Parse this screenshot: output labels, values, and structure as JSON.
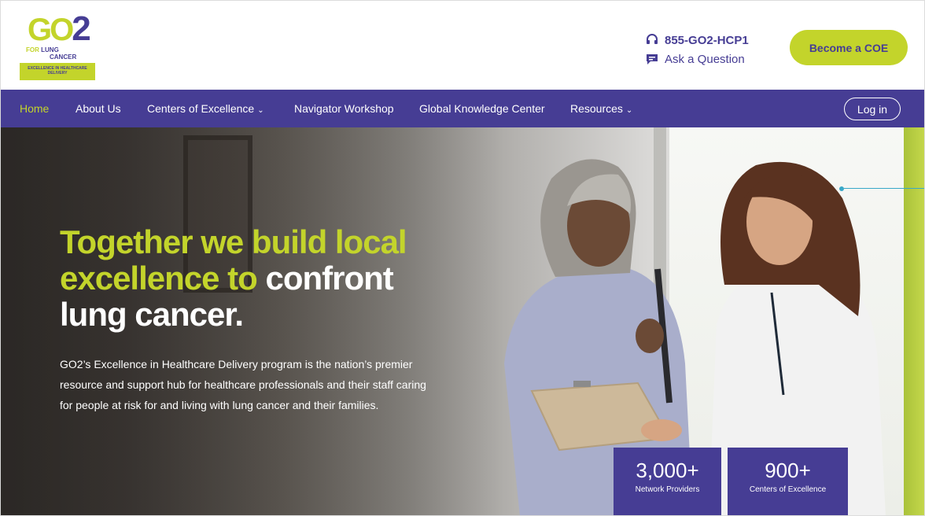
{
  "logo": {
    "go2": "GO",
    "two": "2",
    "for": "FOR",
    "lung": "LUNG",
    "cancer": "CANCER",
    "band": "EXCELLENCE IN HEALTHCARE DELIVERY"
  },
  "header": {
    "phone": "855-GO2-HCP1",
    "ask": "Ask a Question",
    "cta": "Become a COE"
  },
  "nav": {
    "items": [
      {
        "label": "Home",
        "active": true
      },
      {
        "label": "About Us"
      },
      {
        "label": "Centers of Excellence",
        "dropdown": true
      },
      {
        "label": "Navigator Workshop"
      },
      {
        "label": "Global Knowledge Center"
      },
      {
        "label": "Resources",
        "dropdown": true
      }
    ],
    "login": "Log in"
  },
  "hero": {
    "title_green_1": "Together we build local",
    "title_green_2": "excellence to",
    "title_white_2": "confront",
    "title_white_3": "lung cancer.",
    "description": "GO2’s Excellence in Healthcare Delivery program is the nation’s premier resource and support hub for healthcare professionals and their staff caring for people at risk for and living with lung cancer and their families."
  },
  "stats": [
    {
      "number": "3,000+",
      "label": "Network Providers"
    },
    {
      "number": "900+",
      "label": "Centers of Excellence"
    }
  ],
  "colors": {
    "brand_purple": "#463d94",
    "brand_green": "#c3d42b",
    "pointer": "#39a8c8"
  },
  "icons": [
    "headset-icon",
    "chat-icon",
    "chevron-down-icon"
  ]
}
